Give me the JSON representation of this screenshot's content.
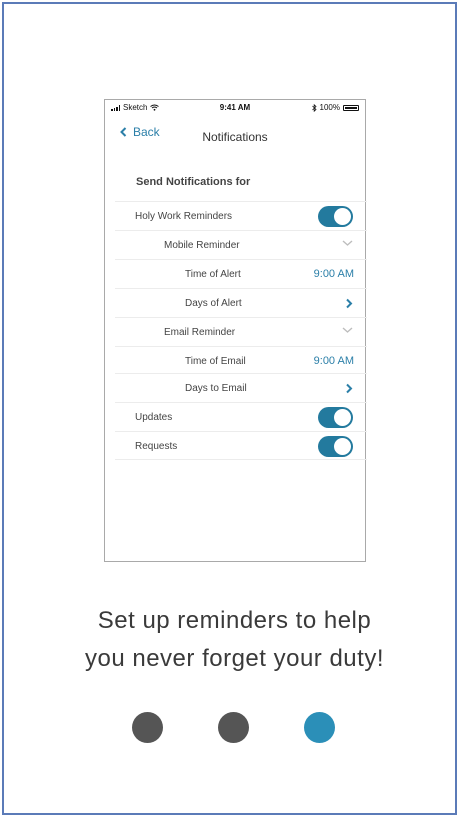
{
  "status_bar": {
    "carrier": "Sketch",
    "time": "9:41 AM",
    "battery": "100%"
  },
  "nav": {
    "back_label": "Back",
    "title": "Notifications"
  },
  "section_title": "Send Notifications for",
  "rows": {
    "holy_work": {
      "label": "Holy Work Reminders",
      "on": true
    },
    "mobile_reminder": {
      "label": "Mobile Reminder"
    },
    "time_of_alert": {
      "label": "Time of Alert",
      "value": "9:00 AM"
    },
    "days_of_alert": {
      "label": "Days of Alert"
    },
    "email_reminder": {
      "label": "Email Reminder"
    },
    "time_of_email": {
      "label": "Time of Email",
      "value": "9:00 AM"
    },
    "days_to_email": {
      "label": "Days to Email"
    },
    "updates": {
      "label": "Updates",
      "on": true
    },
    "requests": {
      "label": "Requests",
      "on": true
    }
  },
  "caption": {
    "line1": "Set up reminders to help",
    "line2": "you never forget your duty!"
  },
  "pagination": {
    "total": 3,
    "active_index": 2,
    "active_color": "#2b8fb8",
    "inactive_color": "#555555"
  },
  "colors": {
    "accent": "#2b7fa8",
    "toggle_on": "#237a9e"
  }
}
